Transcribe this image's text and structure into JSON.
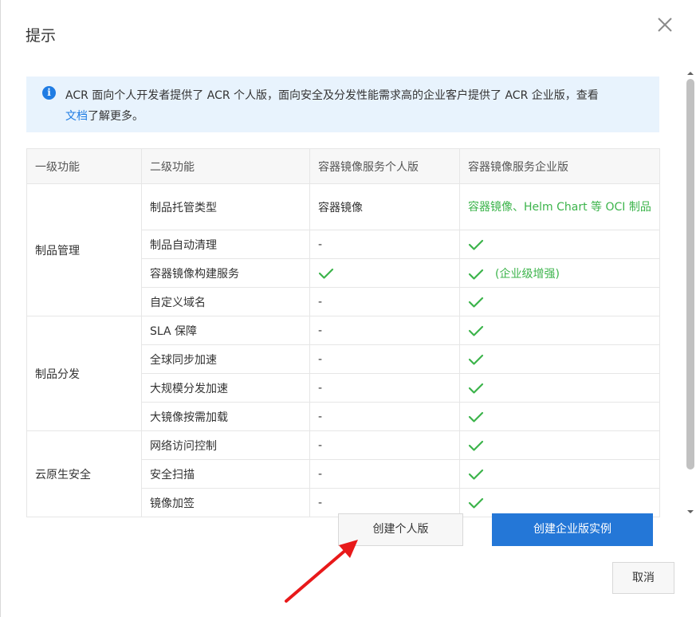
{
  "dialog": {
    "title": "提示",
    "info_text": "ACR 面向个人开发者提供了 ACR 个人版，面向安全及分发性能需求高的企业客户提供了 ACR 企业版，查看",
    "info_link": "文档",
    "info_suffix": "了解更多。"
  },
  "table": {
    "headers": [
      "一级功能",
      "二级功能",
      "容器镜像服务个人版",
      "容器镜像服务企业版"
    ],
    "groups": [
      {
        "name": "制品管理",
        "rows": [
          {
            "feature": "制品托管类型",
            "personal": "容器镜像",
            "enterprise": "容器镜像、Helm Chart 等 OCI 制品"
          },
          {
            "feature": "制品自动清理",
            "personal": "-",
            "enterprise": "check"
          },
          {
            "feature": "容器镜像构建服务",
            "personal": "check",
            "enterprise": "check",
            "note": "(企业级增强)"
          },
          {
            "feature": "自定义域名",
            "personal": "-",
            "enterprise": "check"
          }
        ]
      },
      {
        "name": "制品分发",
        "rows": [
          {
            "feature": "SLA 保障",
            "personal": "-",
            "enterprise": "check"
          },
          {
            "feature": "全球同步加速",
            "personal": "-",
            "enterprise": "check"
          },
          {
            "feature": "大规模分发加速",
            "personal": "-",
            "enterprise": "check"
          },
          {
            "feature": "大镜像按需加载",
            "personal": "-",
            "enterprise": "check"
          }
        ]
      },
      {
        "name": "云原生安全",
        "rows": [
          {
            "feature": "网络访问控制",
            "personal": "-",
            "enterprise": "check"
          },
          {
            "feature": "安全扫描",
            "personal": "-",
            "enterprise": "check"
          },
          {
            "feature": "镜像加签",
            "personal": "-",
            "enterprise": "check"
          }
        ]
      }
    ]
  },
  "buttons": {
    "personal": "创建个人版",
    "enterprise": "创建企业版实例",
    "cancel": "取消"
  },
  "colors": {
    "accent": "#2477d7",
    "check": "#3cb44b",
    "info_bg": "#e8f3fd",
    "annotation_arrow": "#e8191a"
  },
  "icons": {
    "close": "close-icon",
    "info": "info-icon",
    "check": "check-icon",
    "annotation": "red-arrow-annotation"
  }
}
